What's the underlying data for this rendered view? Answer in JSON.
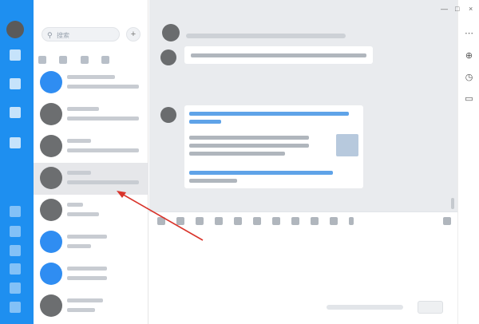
{
  "window": {
    "controls": [
      "—",
      "□",
      "×"
    ]
  },
  "list": {
    "search_placeholder": "搜索",
    "plus_label": "+",
    "items": [
      {
        "name": "",
        "selected": false
      },
      {
        "name": "",
        "selected": false
      },
      {
        "name": "",
        "selected": false
      },
      {
        "name": "",
        "selected": true
      },
      {
        "name": "",
        "selected": false
      },
      {
        "name": "",
        "selected": false
      },
      {
        "name": "",
        "selected": false
      },
      {
        "name": "",
        "selected": false
      }
    ]
  },
  "chat": {
    "header_name": "",
    "time_label": "",
    "send_label": ""
  },
  "right_toolbar": {
    "icons": [
      "more-icon",
      "add-member-icon",
      "history-icon",
      "folder-icon"
    ]
  },
  "colors": {
    "nav_blue": "#1e8ff0",
    "arrow_red": "#d9342b"
  }
}
